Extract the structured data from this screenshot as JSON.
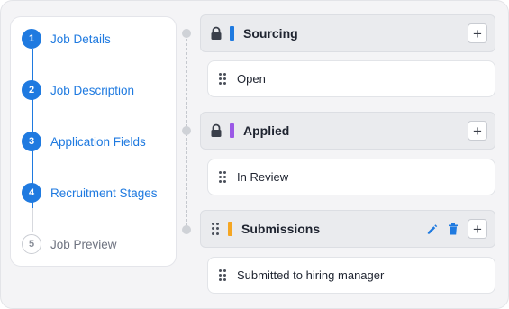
{
  "stepper": {
    "steps": [
      {
        "num": "1",
        "label": "Job Details",
        "state": "done"
      },
      {
        "num": "2",
        "label": "Job Description",
        "state": "done"
      },
      {
        "num": "3",
        "label": "Application Fields",
        "state": "done"
      },
      {
        "num": "4",
        "label": "Recruitment Stages",
        "state": "active"
      },
      {
        "num": "5",
        "label": "Job Preview",
        "state": "pending"
      }
    ]
  },
  "stages": [
    {
      "title": "Sourcing",
      "color": "#1f7ae0",
      "locked": true,
      "status": "Open",
      "add_label": "+"
    },
    {
      "title": "Applied",
      "color": "#9b59e6",
      "locked": true,
      "status": "In Review",
      "add_label": "+"
    },
    {
      "title": "Submissions",
      "color": "#f5a623",
      "locked": false,
      "status": "Submitted to hiring manager",
      "add_label": "+"
    }
  ],
  "colors": {
    "accent": "#1f7ae0",
    "edit": "#1f7ae0",
    "delete": "#1f7ae0"
  }
}
